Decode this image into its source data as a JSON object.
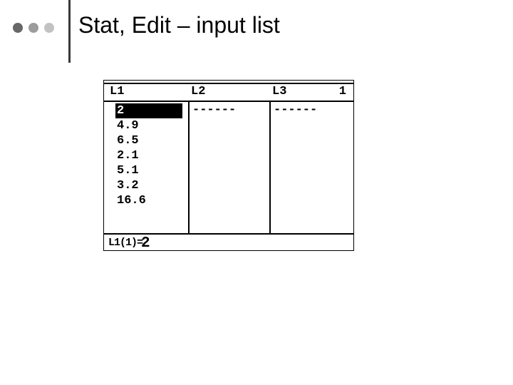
{
  "title": "Stat, Edit – input list",
  "headers": {
    "l1": "L1",
    "l2": "L2",
    "l3": "L3",
    "num": "1"
  },
  "l1_values": [
    "2",
    "4.9",
    "6.5",
    "2.1",
    "5.1",
    "3.2",
    "16.6"
  ],
  "selected_index": 0,
  "dash": "------",
  "status": {
    "lhs": "L1(1)=",
    "rhs": "2"
  }
}
